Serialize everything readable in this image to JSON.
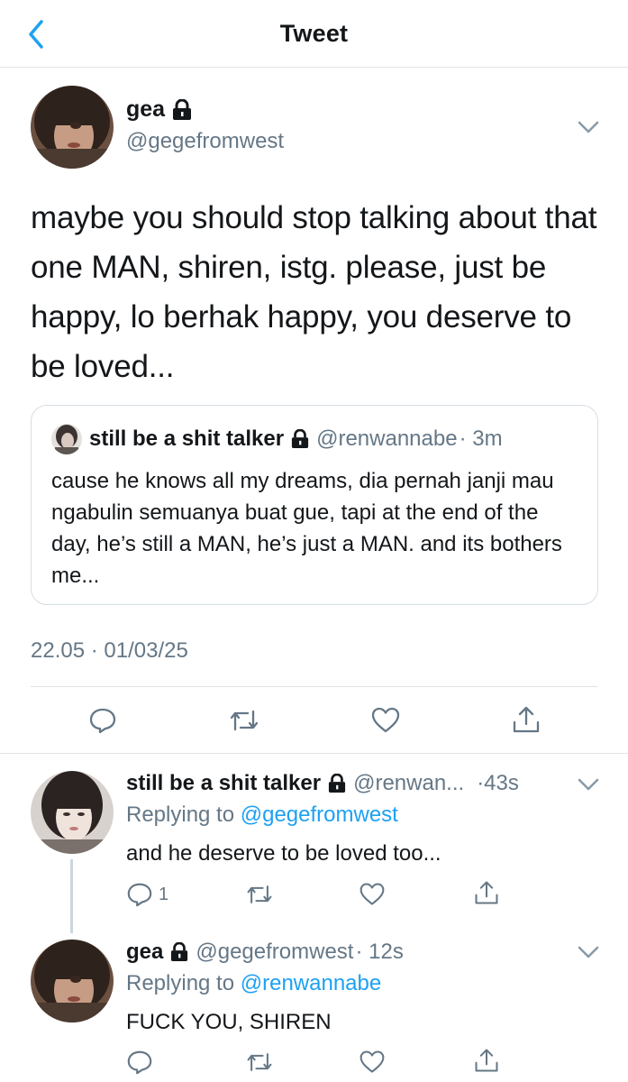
{
  "header": {
    "title": "Tweet",
    "back_icon": "chevron-left-icon",
    "accent": "#1da1f2"
  },
  "main_tweet": {
    "name": "gea",
    "handle": "@gegefromwest",
    "text": "maybe you should stop talking about that one MAN, shiren, istg. please, just be happy, lo berhak happy, you deserve to be loved...",
    "quote": {
      "name": "still be a shit talker",
      "handle": "@renwannabe",
      "time": "· 3m",
      "text": "cause he knows all my dreams, dia pernah janji mau ngabulin semuanya buat gue, tapi at the end of the day, he’s still a MAN, he’s just a MAN. and its bothers me..."
    },
    "timestamp": "22.05 · 01/03/25"
  },
  "replies": [
    {
      "name": "still be a shit talker",
      "handle": "@renwan...",
      "time": "·43s",
      "replying_prefix": "Replying to",
      "replying_to": "@gegefromwest",
      "text": "and he deserve to be loved too...",
      "reply_count": "1"
    },
    {
      "name": "gea",
      "handle": "@gegefromwest",
      "time": "· 12s",
      "replying_prefix": "Replying to",
      "replying_to": "@renwannabe",
      "text": "FUCK YOU, SHIREN",
      "reply_count": ""
    }
  ],
  "icons": [
    "lock-icon",
    "reply-icon",
    "retweet-icon",
    "like-icon",
    "share-icon",
    "chevron-down-icon"
  ]
}
